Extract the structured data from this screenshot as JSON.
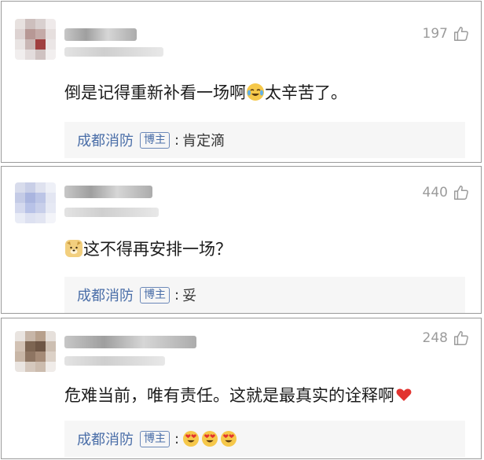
{
  "comments": [
    {
      "likes": "197",
      "text": "倒是记得重新补看一场啊",
      "emoji": "cry-laugh-emoji",
      "text_after": "太辛苦了。",
      "reply": {
        "author": "成都消防",
        "badge": "博主",
        "text": "肯定滴"
      }
    },
    {
      "likes": "440",
      "emoji": "doge-emoji",
      "text": "这不得再安排一场？",
      "reply": {
        "author": "成都消防",
        "badge": "博主",
        "text": "妥"
      }
    },
    {
      "likes": "248",
      "text": "危难当前，唯有责任。这就是最真实的诠释啊",
      "emoji": "red-heart-emoji",
      "reply": {
        "author": "成都消防",
        "badge": "博主",
        "emojis": [
          "heart-eyes-emoji",
          "heart-eyes-emoji",
          "heart-eyes-emoji"
        ]
      }
    }
  ],
  "colors": {
    "author": "#4a6ea8",
    "likes": "#9b9b9b",
    "reply_bg": "#f6f6f6",
    "heart": "#e2332f"
  }
}
